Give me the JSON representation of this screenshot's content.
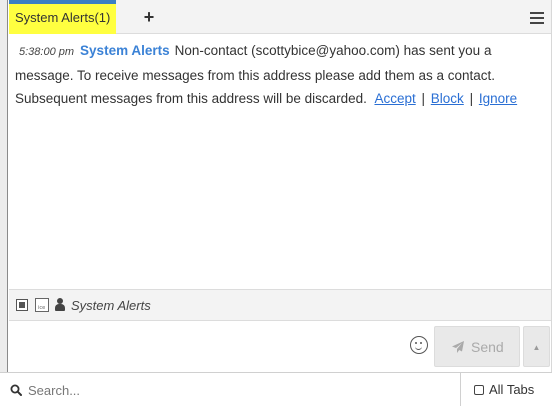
{
  "tabbar": {
    "active_tab_label": "System Alerts(1)",
    "add_tab_label": "+",
    "menu_icon": "hamburger-menu-icon",
    "active_tab_color": "#ffff40",
    "active_tab_accent": "#3b7fc4"
  },
  "messages": [
    {
      "time": "5:38:00 pm",
      "sender": "System Alerts",
      "text": "Non-contact (scottybice@yahoo.com) has sent you a message.  To receive messages from this address please add them as a contact.  Subsequent messages from this address will be discarded.",
      "actions": {
        "accept": "Accept",
        "block": "Block",
        "ignore": "Ignore",
        "separator": "|"
      }
    }
  ],
  "statusbar": {
    "icons": [
      "square-stop-icon",
      "chat-log-icon",
      "user-icon"
    ],
    "label": "System Alerts"
  },
  "composer": {
    "emoji_icon": "smiley-icon",
    "send_label": "Send",
    "send_icon": "paper-plane-icon",
    "dropdown_icon": "caret-up-icon"
  },
  "search": {
    "icon": "search-icon",
    "placeholder": "Search...",
    "all_tabs_label": "All Tabs",
    "all_tabs_checked": false
  },
  "colors": {
    "sender_blue": "#3b82d6",
    "link_blue": "#2a6fd4"
  }
}
